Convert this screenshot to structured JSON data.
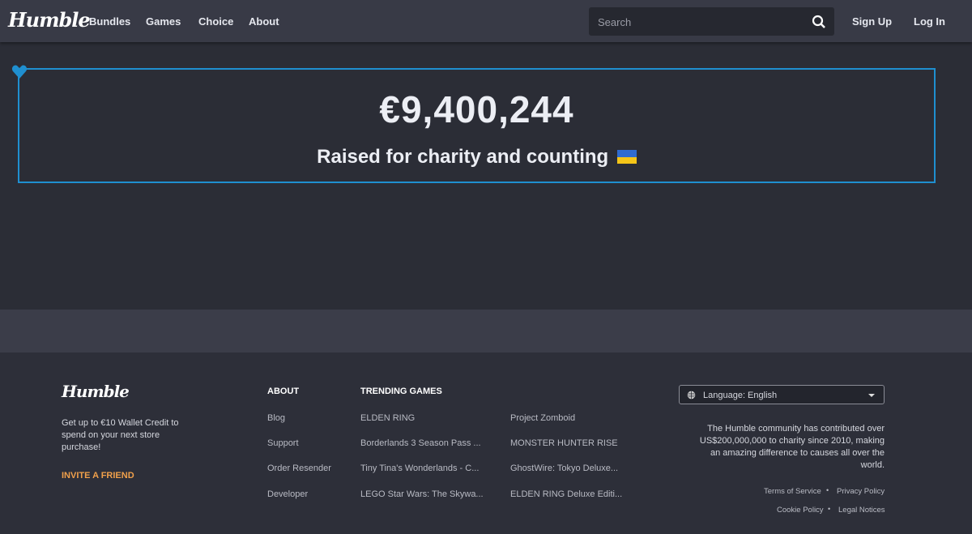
{
  "header": {
    "logo": "Humble",
    "nav": [
      "Bundles",
      "Games",
      "Choice",
      "About"
    ],
    "search_placeholder": "Search",
    "sign_up": "Sign Up",
    "log_in": "Log In"
  },
  "charity": {
    "amount": "€9,400,244",
    "subtitle": "Raised for charity and counting",
    "accent": "#1f8fd0"
  },
  "footer": {
    "logo": "Humble",
    "promo": "Get up to €10 Wallet Credit to spend on your next store purchase!",
    "invite": "INVITE A FRIEND",
    "about_heading": "ABOUT",
    "about_links": [
      "Blog",
      "Support",
      "Order Resender",
      "Developer"
    ],
    "trending_heading": "TRENDING GAMES",
    "trending_col1": [
      "ELDEN RING",
      "Borderlands 3 Season Pass ...",
      "Tiny Tina's Wonderlands - C...",
      "LEGO Star Wars: The Skywa..."
    ],
    "trending_col2": [
      "Project Zomboid",
      "MONSTER HUNTER RISE",
      "GhostWire: Tokyo Deluxe...",
      "ELDEN RING Deluxe Editi..."
    ],
    "language": "Language: English",
    "charity_text": "The Humble community has contributed over US$200,000,000 to charity since 2010, making an amazing difference to causes all over the world.",
    "legal": [
      "Terms of Service",
      "Privacy Policy",
      "Cookie Policy",
      "Legal Notices"
    ]
  }
}
